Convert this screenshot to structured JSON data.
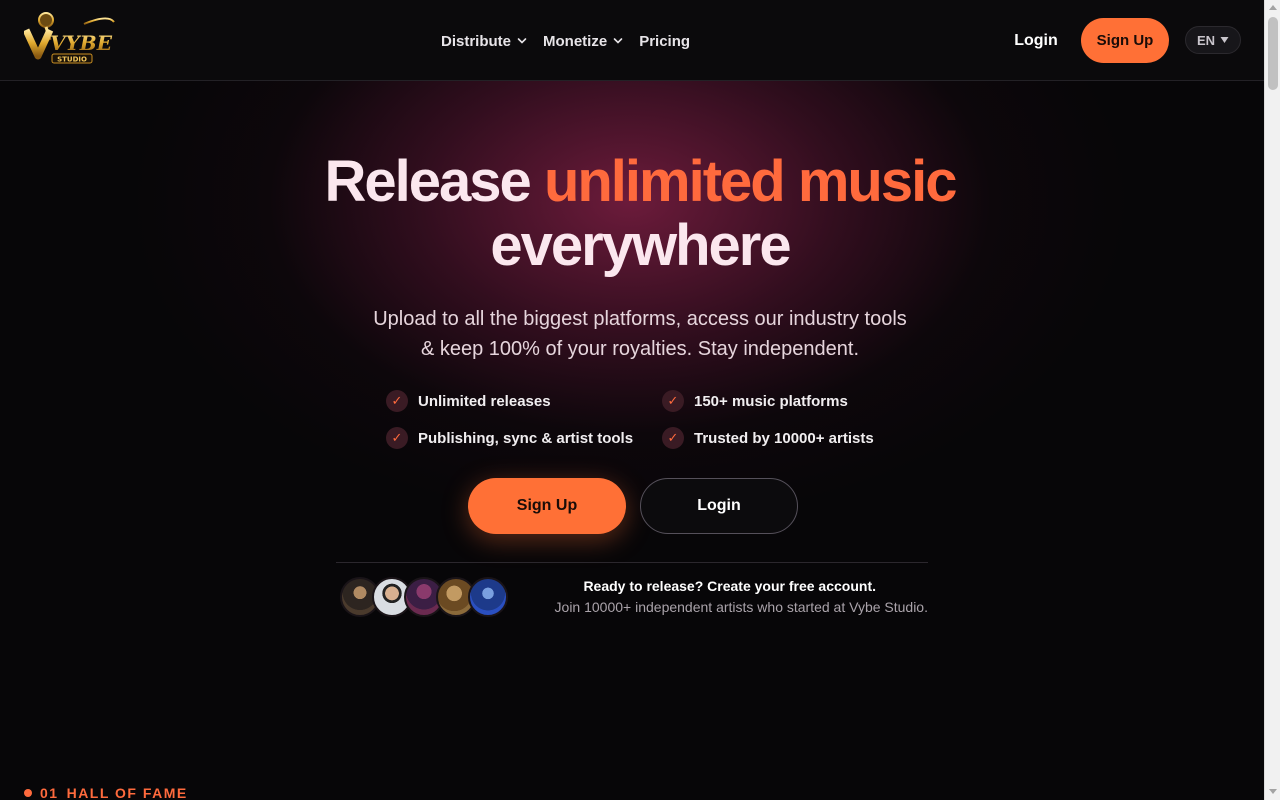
{
  "header": {
    "logo_text": "VYBE",
    "logo_subtext": "STUDIO",
    "nav": [
      {
        "label": "Distribute",
        "has_dropdown": true
      },
      {
        "label": "Monetize",
        "has_dropdown": true
      },
      {
        "label": "Pricing",
        "has_dropdown": false
      }
    ],
    "login_label": "Login",
    "signup_label": "Sign Up",
    "language": "EN"
  },
  "hero": {
    "headline_part1": "Release",
    "headline_accent": "unlimited music",
    "headline_part2": "everywhere",
    "subtitle_line1": "Upload to all the biggest platforms, access our industry tools",
    "subtitle_line2": "& keep 100% of your royalties. Stay independent.",
    "features": [
      "Unlimited releases",
      "150+ music platforms",
      "Publishing, sync & artist tools",
      "Trusted by 10000+ artists"
    ],
    "check_glyph": "✓",
    "signup_label": "Sign Up",
    "login_label": "Login"
  },
  "cta": {
    "title": "Ready to release? Create your free account.",
    "subtitle": "Join 10000+ independent artists who started at Vybe Studio."
  },
  "section": {
    "number": "01",
    "label": "HALL OF FAME"
  },
  "colors": {
    "accent": "#ff7036",
    "accent_text": "#ff6a3d",
    "background": "#070608",
    "headline": "#fbe7ee"
  }
}
